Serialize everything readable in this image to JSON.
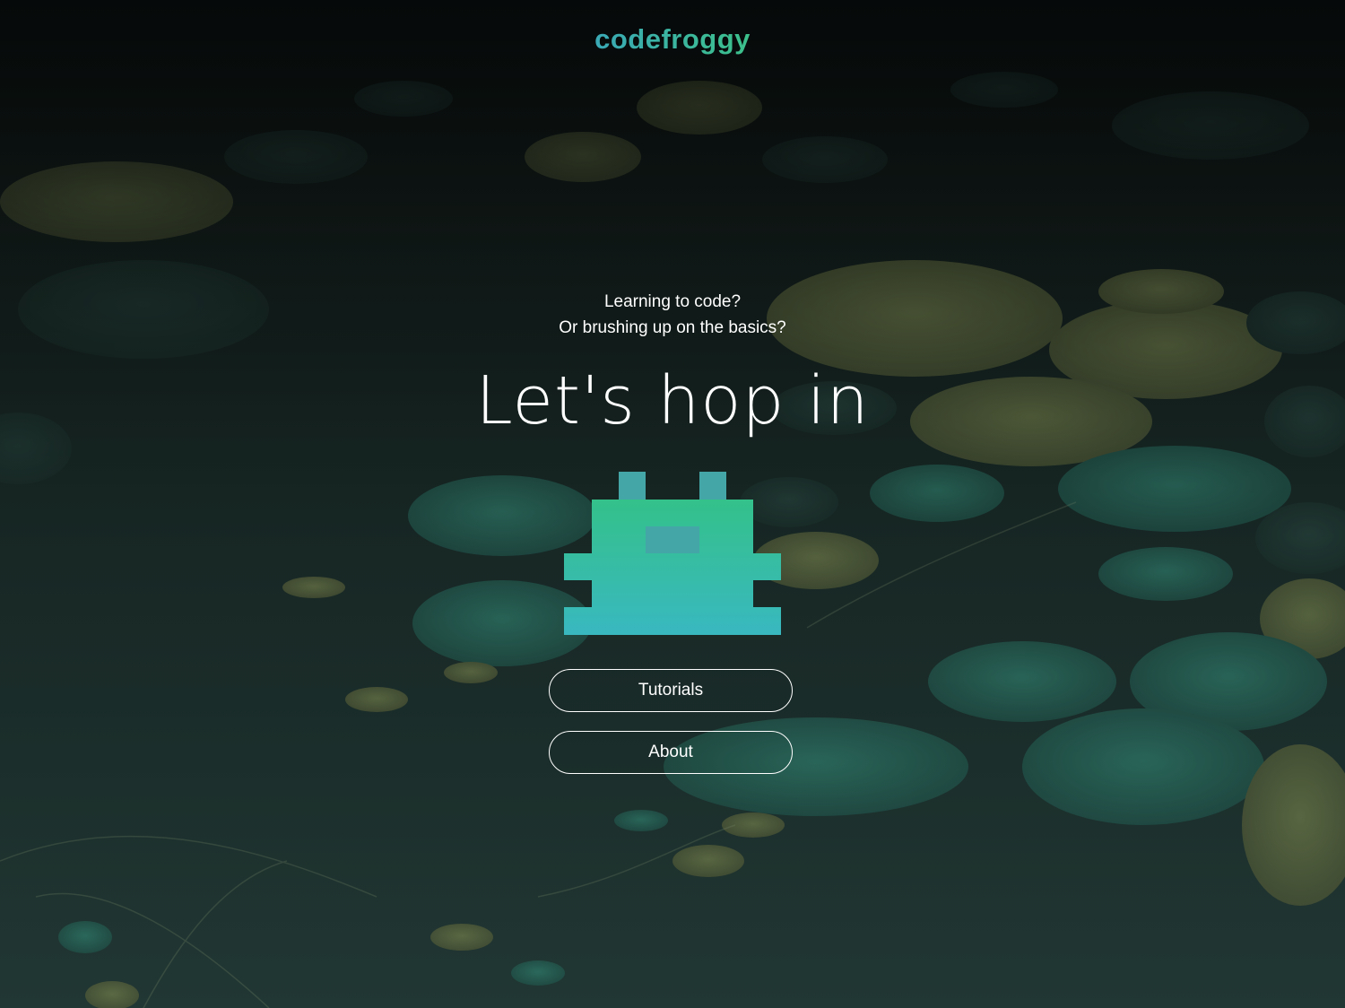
{
  "header": {
    "logo_text": "codefroggy"
  },
  "hero": {
    "subtitle_line1": "Learning to code?",
    "subtitle_line2": "Or brushing up on the basics?",
    "headline": "Let's hop in"
  },
  "nav": {
    "tutorials_label": "Tutorials",
    "about_label": "About"
  },
  "colors": {
    "logo_gradient_start": "#3aa9b6",
    "logo_gradient_end": "#3cc08a",
    "frog_top": "#34c18a",
    "frog_bottom": "#39b8c0",
    "frog_eyes": "#45a6a8",
    "text": "#ffffff"
  },
  "icons": {
    "mascot": "pixel-frog-icon"
  }
}
